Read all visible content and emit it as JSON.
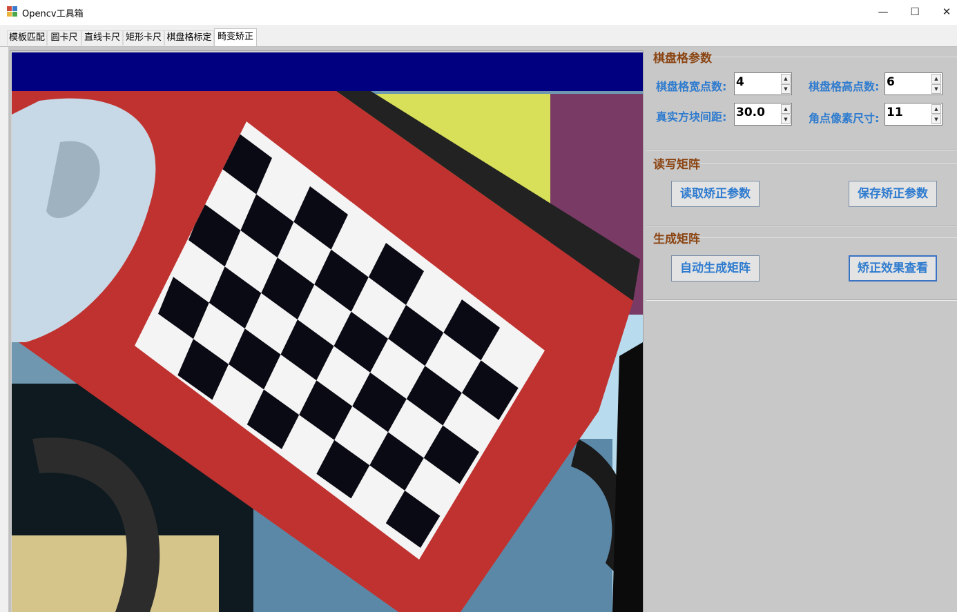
{
  "window": {
    "title": "Opencv工具箱",
    "minimize_glyph": "—",
    "maximize_glyph": "☐",
    "close_glyph": "✕",
    "icon": "app-window-icon"
  },
  "tabs": [
    {
      "label": "模板匹配",
      "active": false
    },
    {
      "label": "圆卡尺",
      "active": false
    },
    {
      "label": "直线卡尺",
      "active": false
    },
    {
      "label": "矩形卡尺",
      "active": false
    },
    {
      "label": "棋盘格标定",
      "active": false
    },
    {
      "label": "畸变矫正",
      "active": true
    }
  ],
  "chessboard_params": {
    "title": "棋盘格参数",
    "width_points": {
      "label": "棋盘格宽点数:",
      "value": "4"
    },
    "height_points": {
      "label": "棋盘格高点数:",
      "value": "6"
    },
    "square_spacing": {
      "label": "真实方块间距:",
      "value": "30.0"
    },
    "corner_pixel_size": {
      "label": "角点像素尺寸:",
      "value": "11"
    }
  },
  "read_write_matrix": {
    "title": "读写矩阵",
    "read_button": "读取矫正参数",
    "save_button": "保存矫正参数"
  },
  "generate_matrix": {
    "title": "生成矩阵",
    "auto_generate_button": "自动生成矩阵",
    "view_result_button": "矫正效果查看"
  },
  "colors": {
    "group_title": "#8b4513",
    "label_blue": "#2e7bcf",
    "panel_bg": "#c8c8c8",
    "image_top_band": "#000080",
    "board_red": "#c0322f"
  },
  "icons": {
    "spin_up": "▲",
    "spin_down": "▼"
  }
}
